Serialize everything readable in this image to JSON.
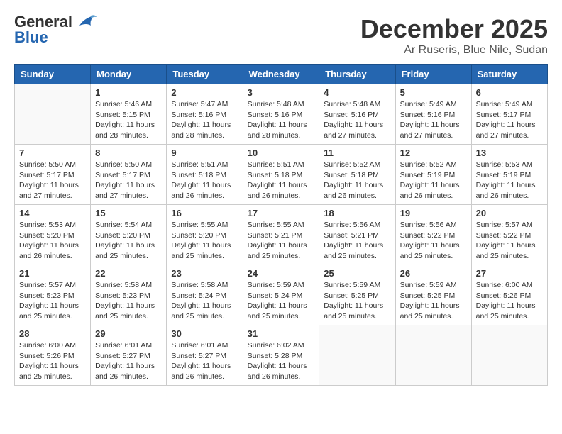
{
  "header": {
    "logo_general": "General",
    "logo_blue": "Blue",
    "month_year": "December 2025",
    "location": "Ar Ruseris, Blue Nile, Sudan"
  },
  "weekdays": [
    "Sunday",
    "Monday",
    "Tuesday",
    "Wednesday",
    "Thursday",
    "Friday",
    "Saturday"
  ],
  "weeks": [
    [
      {
        "day": "",
        "sunrise": "",
        "sunset": "",
        "daylight": ""
      },
      {
        "day": "1",
        "sunrise": "Sunrise: 5:46 AM",
        "sunset": "Sunset: 5:15 PM",
        "daylight": "Daylight: 11 hours and 28 minutes."
      },
      {
        "day": "2",
        "sunrise": "Sunrise: 5:47 AM",
        "sunset": "Sunset: 5:16 PM",
        "daylight": "Daylight: 11 hours and 28 minutes."
      },
      {
        "day": "3",
        "sunrise": "Sunrise: 5:48 AM",
        "sunset": "Sunset: 5:16 PM",
        "daylight": "Daylight: 11 hours and 28 minutes."
      },
      {
        "day": "4",
        "sunrise": "Sunrise: 5:48 AM",
        "sunset": "Sunset: 5:16 PM",
        "daylight": "Daylight: 11 hours and 27 minutes."
      },
      {
        "day": "5",
        "sunrise": "Sunrise: 5:49 AM",
        "sunset": "Sunset: 5:16 PM",
        "daylight": "Daylight: 11 hours and 27 minutes."
      },
      {
        "day": "6",
        "sunrise": "Sunrise: 5:49 AM",
        "sunset": "Sunset: 5:17 PM",
        "daylight": "Daylight: 11 hours and 27 minutes."
      }
    ],
    [
      {
        "day": "7",
        "sunrise": "Sunrise: 5:50 AM",
        "sunset": "Sunset: 5:17 PM",
        "daylight": "Daylight: 11 hours and 27 minutes."
      },
      {
        "day": "8",
        "sunrise": "Sunrise: 5:50 AM",
        "sunset": "Sunset: 5:17 PM",
        "daylight": "Daylight: 11 hours and 27 minutes."
      },
      {
        "day": "9",
        "sunrise": "Sunrise: 5:51 AM",
        "sunset": "Sunset: 5:18 PM",
        "daylight": "Daylight: 11 hours and 26 minutes."
      },
      {
        "day": "10",
        "sunrise": "Sunrise: 5:51 AM",
        "sunset": "Sunset: 5:18 PM",
        "daylight": "Daylight: 11 hours and 26 minutes."
      },
      {
        "day": "11",
        "sunrise": "Sunrise: 5:52 AM",
        "sunset": "Sunset: 5:18 PM",
        "daylight": "Daylight: 11 hours and 26 minutes."
      },
      {
        "day": "12",
        "sunrise": "Sunrise: 5:52 AM",
        "sunset": "Sunset: 5:19 PM",
        "daylight": "Daylight: 11 hours and 26 minutes."
      },
      {
        "day": "13",
        "sunrise": "Sunrise: 5:53 AM",
        "sunset": "Sunset: 5:19 PM",
        "daylight": "Daylight: 11 hours and 26 minutes."
      }
    ],
    [
      {
        "day": "14",
        "sunrise": "Sunrise: 5:53 AM",
        "sunset": "Sunset: 5:20 PM",
        "daylight": "Daylight: 11 hours and 26 minutes."
      },
      {
        "day": "15",
        "sunrise": "Sunrise: 5:54 AM",
        "sunset": "Sunset: 5:20 PM",
        "daylight": "Daylight: 11 hours and 25 minutes."
      },
      {
        "day": "16",
        "sunrise": "Sunrise: 5:55 AM",
        "sunset": "Sunset: 5:20 PM",
        "daylight": "Daylight: 11 hours and 25 minutes."
      },
      {
        "day": "17",
        "sunrise": "Sunrise: 5:55 AM",
        "sunset": "Sunset: 5:21 PM",
        "daylight": "Daylight: 11 hours and 25 minutes."
      },
      {
        "day": "18",
        "sunrise": "Sunrise: 5:56 AM",
        "sunset": "Sunset: 5:21 PM",
        "daylight": "Daylight: 11 hours and 25 minutes."
      },
      {
        "day": "19",
        "sunrise": "Sunrise: 5:56 AM",
        "sunset": "Sunset: 5:22 PM",
        "daylight": "Daylight: 11 hours and 25 minutes."
      },
      {
        "day": "20",
        "sunrise": "Sunrise: 5:57 AM",
        "sunset": "Sunset: 5:22 PM",
        "daylight": "Daylight: 11 hours and 25 minutes."
      }
    ],
    [
      {
        "day": "21",
        "sunrise": "Sunrise: 5:57 AM",
        "sunset": "Sunset: 5:23 PM",
        "daylight": "Daylight: 11 hours and 25 minutes."
      },
      {
        "day": "22",
        "sunrise": "Sunrise: 5:58 AM",
        "sunset": "Sunset: 5:23 PM",
        "daylight": "Daylight: 11 hours and 25 minutes."
      },
      {
        "day": "23",
        "sunrise": "Sunrise: 5:58 AM",
        "sunset": "Sunset: 5:24 PM",
        "daylight": "Daylight: 11 hours and 25 minutes."
      },
      {
        "day": "24",
        "sunrise": "Sunrise: 5:59 AM",
        "sunset": "Sunset: 5:24 PM",
        "daylight": "Daylight: 11 hours and 25 minutes."
      },
      {
        "day": "25",
        "sunrise": "Sunrise: 5:59 AM",
        "sunset": "Sunset: 5:25 PM",
        "daylight": "Daylight: 11 hours and 25 minutes."
      },
      {
        "day": "26",
        "sunrise": "Sunrise: 5:59 AM",
        "sunset": "Sunset: 5:25 PM",
        "daylight": "Daylight: 11 hours and 25 minutes."
      },
      {
        "day": "27",
        "sunrise": "Sunrise: 6:00 AM",
        "sunset": "Sunset: 5:26 PM",
        "daylight": "Daylight: 11 hours and 25 minutes."
      }
    ],
    [
      {
        "day": "28",
        "sunrise": "Sunrise: 6:00 AM",
        "sunset": "Sunset: 5:26 PM",
        "daylight": "Daylight: 11 hours and 25 minutes."
      },
      {
        "day": "29",
        "sunrise": "Sunrise: 6:01 AM",
        "sunset": "Sunset: 5:27 PM",
        "daylight": "Daylight: 11 hours and 26 minutes."
      },
      {
        "day": "30",
        "sunrise": "Sunrise: 6:01 AM",
        "sunset": "Sunset: 5:27 PM",
        "daylight": "Daylight: 11 hours and 26 minutes."
      },
      {
        "day": "31",
        "sunrise": "Sunrise: 6:02 AM",
        "sunset": "Sunset: 5:28 PM",
        "daylight": "Daylight: 11 hours and 26 minutes."
      },
      {
        "day": "",
        "sunrise": "",
        "sunset": "",
        "daylight": ""
      },
      {
        "day": "",
        "sunrise": "",
        "sunset": "",
        "daylight": ""
      },
      {
        "day": "",
        "sunrise": "",
        "sunset": "",
        "daylight": ""
      }
    ]
  ]
}
